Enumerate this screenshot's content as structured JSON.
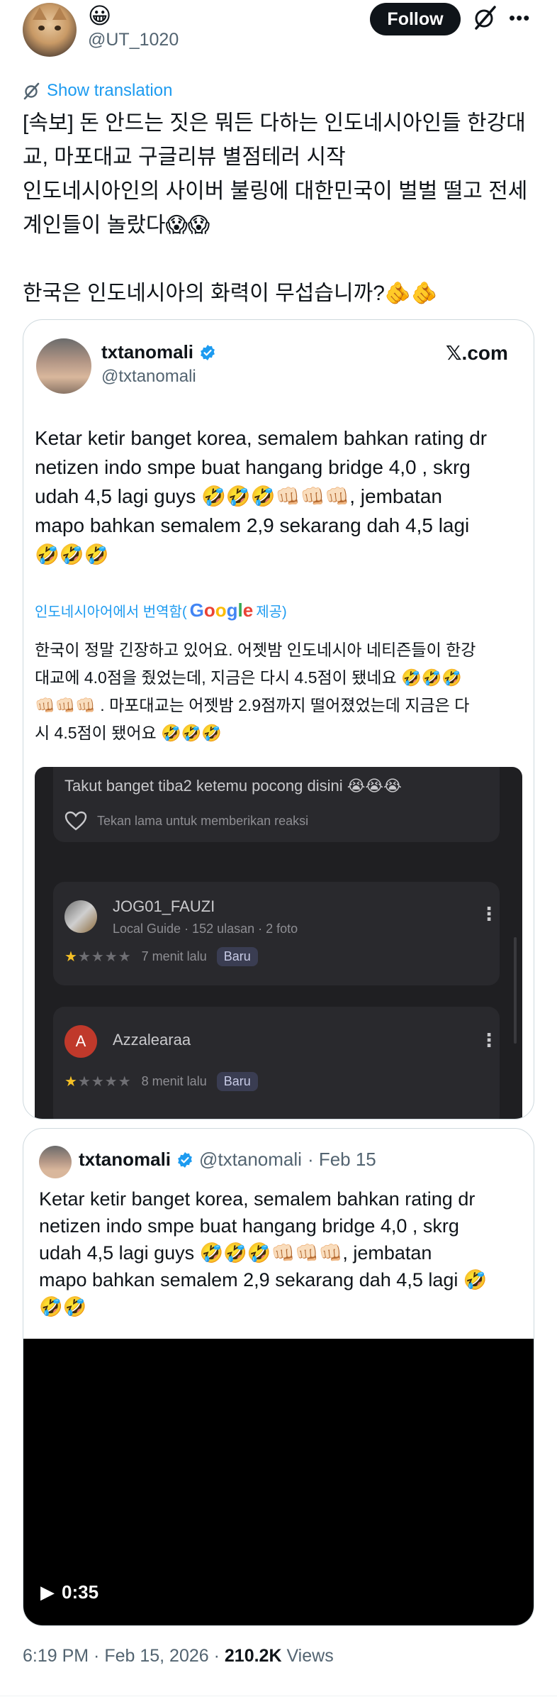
{
  "author": {
    "display_name": "😀",
    "handle": "@UT_1020"
  },
  "actions": {
    "follow_label": "Follow",
    "more_label": "•••"
  },
  "translate": {
    "label": "Show translation"
  },
  "tweet": {
    "text": "[속보] 돈 안드는 짓은 뭐든 다하는 인도네시아인들 한강대\n교, 마포대교 구글리뷰 별점테러 시작\n인도네시아인의 사이버 불링에 대한민국이 벌벌 떨고 전세\n계인들이 놀랐다😱😱\n\n한국은 인도네시아의 화력이 무섭습니까?🫵🫵"
  },
  "quote1": {
    "name": "txtanomali",
    "handle": "@txtanomali",
    "source": "𝕏.com",
    "text": "Ketar ketir banget korea, semalem bahkan rating dr\nnetizen indo smpe buat hangang bridge 4,0 , skrg\nudah 4,5 lagi guys 🤣🤣🤣👊🏻👊🏻👊🏻, jembatan\nmapo bahkan semalem 2,9 sekarang dah 4,5 lagi\n🤣🤣🤣",
    "translated_by_prefix": "인도네시아어에서 번역함(",
    "google": [
      "G",
      "o",
      "o",
      "g",
      "l",
      "e"
    ],
    "translated_by_suffix": " 제공)",
    "translation": "한국이 정말 긴장하고 있어요. 어젯밤 인도네시아 네티즌들이 한강\n대교에 4.0점을 줬었는데, 지금은 다시 4.5점이 됐네요 🤣🤣🤣\n👊🏻👊🏻👊🏻 . 마포대교는 어젯밤 2.9점까지 떨어졌었는데 지금은 다\n시 4.5점이 됐어요 🤣🤣🤣",
    "screenshot": {
      "review_text": "Takut banget tiba2 ketemu pocong disini 😭😭😭",
      "react_hint": "Tekan lama untuk memberikan reaksi",
      "reviews": [
        {
          "name": "JOG01_FAUZI",
          "meta": "Local Guide · 152 ulasan · 2 foto",
          "time": "7 menit lalu",
          "badge": "Baru",
          "rating": 1
        },
        {
          "name": "Azzalearaa",
          "initial": "A",
          "time": "8 menit lalu",
          "badge": "Baru",
          "rating": 1
        }
      ]
    }
  },
  "quote2": {
    "name": "txtanomali",
    "handle": "@txtanomali",
    "date": "· Feb 15",
    "text": "Ketar ketir banget korea, semalem bahkan rating dr\nnetizen indo smpe buat hangang bridge 4,0 , skrg\nudah 4,5 lagi guys 🤣🤣🤣👊🏻👊🏻👊🏻, jembatan\nmapo bahkan semalem 2,9 sekarang dah 4,5 lagi 🤣\n🤣🤣",
    "video_duration": "0:35"
  },
  "footer": {
    "timestamp": "6:19 PM · Feb 15, 2026 · ",
    "views_count": "210.2K",
    "views_label": " Views"
  },
  "colors": {
    "accent": "#1d9bf0",
    "text": "#0f1419",
    "muted": "#536471",
    "verified": "#1d9bf0"
  }
}
